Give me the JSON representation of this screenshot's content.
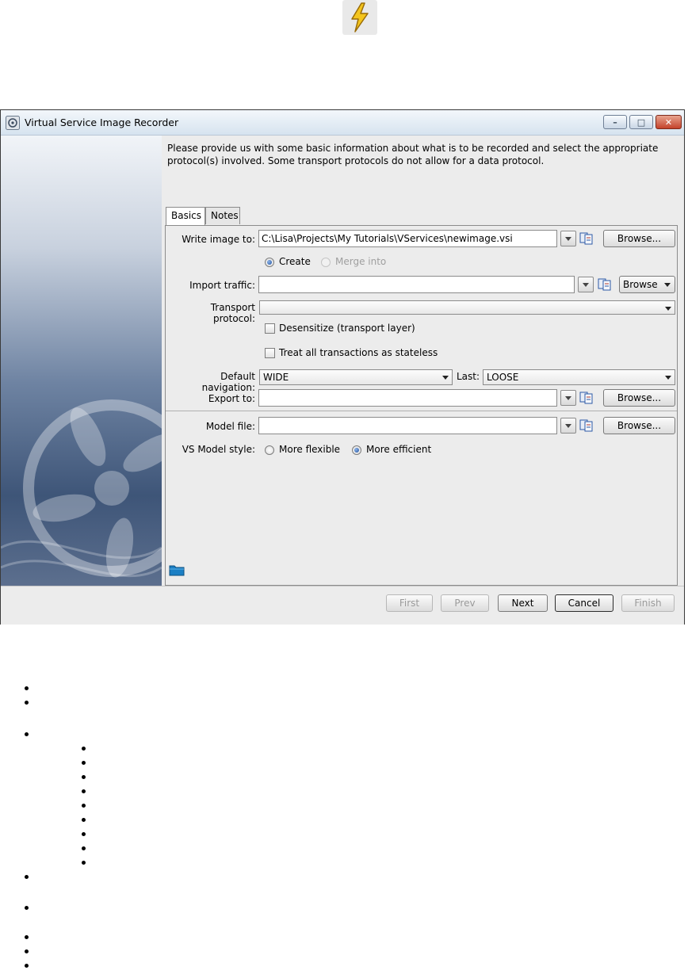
{
  "window": {
    "title": "Virtual Service Image Recorder"
  },
  "description": "Please provide us with some basic information about what is to be recorded and select the appropriate protocol(s) involved.  Some transport protocols do not allow for a data protocol.",
  "tabs": [
    {
      "label": "Basics",
      "active": true
    },
    {
      "label": "Notes",
      "active": false
    }
  ],
  "form": {
    "write_image": {
      "label": "Write image to:",
      "value": "C:\\Lisa\\Projects\\My Tutorials\\VServices\\newimage.vsi",
      "browse": "Browse..."
    },
    "image_mode": {
      "create": "Create",
      "merge": "Merge into",
      "selected": "create"
    },
    "import_traffic": {
      "label": "Import traffic:",
      "value": "",
      "browse": "Browse"
    },
    "transport_protocol": {
      "label": "Transport protocol:",
      "value": ""
    },
    "desensitize": {
      "label": "Desensitize (transport layer)",
      "checked": false
    },
    "stateless": {
      "label": "Treat all transactions as stateless",
      "checked": false
    },
    "default_navigation": {
      "label": "Default navigation:",
      "value": "WIDE"
    },
    "last": {
      "label": "Last:",
      "value": "LOOSE"
    },
    "export_to": {
      "label": "Export to:",
      "value": "",
      "browse": "Browse..."
    },
    "model_file": {
      "label": "Model file:",
      "value": "",
      "browse": "Browse..."
    },
    "model_style": {
      "label": "VS Model style:",
      "flexible": "More flexible",
      "efficient": "More efficient",
      "selected": "efficient"
    }
  },
  "footer": {
    "first": "First",
    "prev": "Prev",
    "next": "Next",
    "cancel": "Cancel",
    "finish": "Finish"
  },
  "colors": {
    "lightning": "#f0c419",
    "selected_radio": "#1d4f9c"
  }
}
